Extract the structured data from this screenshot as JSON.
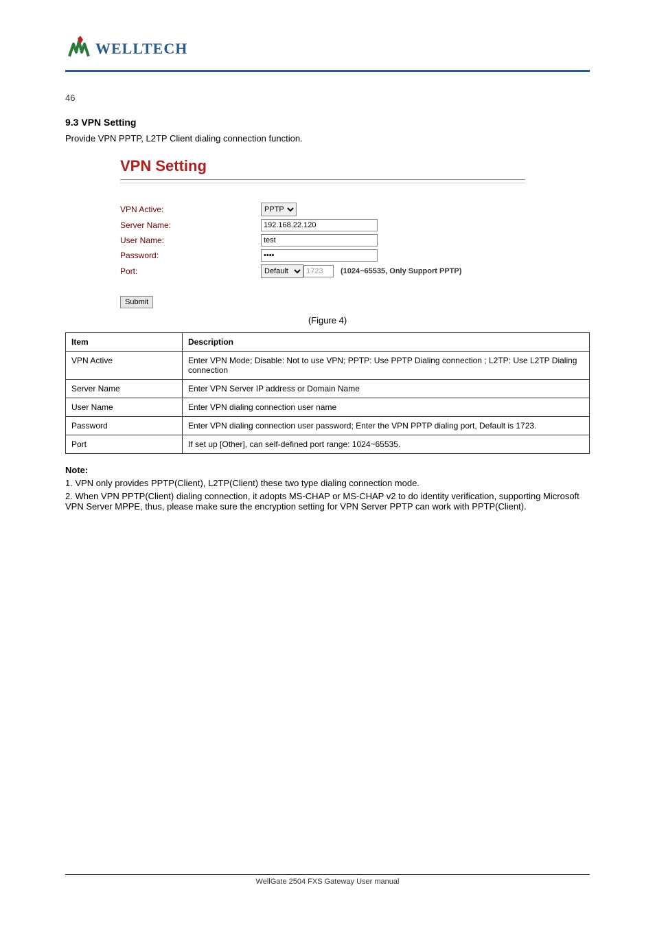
{
  "logo_text": "WELLTECH",
  "page_number": "46",
  "section_title": "9.3 VPN Setting",
  "section_desc": "Provide VPN PPTP, L2TP Client dialing connection function.",
  "vpn": {
    "title": "VPN Setting",
    "labels": {
      "active": "VPN Active:",
      "server": "Server Name:",
      "user": "User Name:",
      "password": "Password:",
      "port": "Port:"
    },
    "values": {
      "active_option": "PPTP",
      "server": "192.168.22.120",
      "user": "test",
      "password": "••••",
      "port_mode": "Default",
      "port": "1723"
    },
    "hint": "(1024~65535, Only Support PPTP)",
    "submit": "Submit"
  },
  "figure_caption": "(Figure 4)",
  "table": {
    "headers": [
      "Item",
      "Description"
    ],
    "rows": [
      [
        "VPN Active",
        "Enter VPN Mode; Disable: Not to use VPN; PPTP: Use PPTP Dialing connection ; L2TP: Use L2TP Dialing connection"
      ],
      [
        "Server Name",
        "Enter VPN Server IP address or Domain Name"
      ],
      [
        "User Name",
        "Enter VPN dialing connection user name"
      ],
      [
        "Password",
        "Enter VPN dialing connection user password; Enter the VPN PPTP dialing port, Default is 1723."
      ],
      [
        "Port",
        "If set up [Other], can self-defined port range: 1024~65535."
      ]
    ]
  },
  "notes": {
    "title": "Note:",
    "lines": [
      "1. VPN only provides PPTP(Client), L2TP(Client) these two type dialing connection mode.",
      "2. When VPN PPTP(Client) dialing connection, it adopts MS-CHAP or MS-CHAP v2 to do identity verification, supporting Microsoft VPN Server MPPE, thus, please make sure the encryption setting for VPN Server PPTP can work with PPTP(Client)."
    ]
  },
  "footer": "WellGate 2504 FXS Gateway User manual"
}
